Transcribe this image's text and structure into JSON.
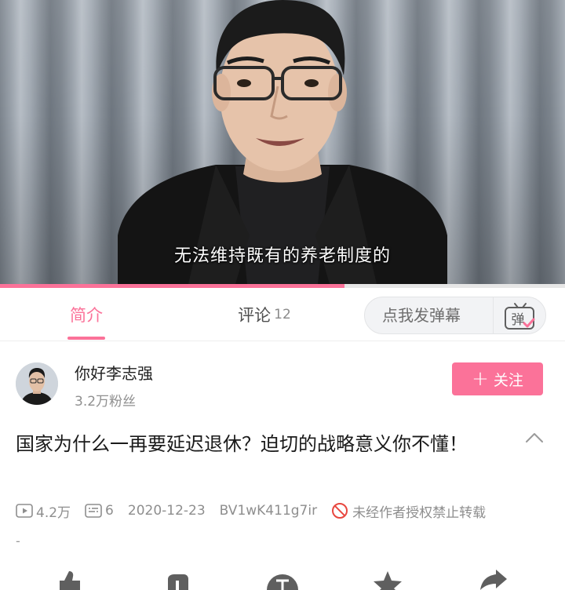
{
  "video": {
    "subtitle": "无法维持既有的养老制度的",
    "progress": 0.61
  },
  "tabs": {
    "intro_label": "简介",
    "comments_label": "评论",
    "comments_count": "12"
  },
  "danmaku_input": {
    "placeholder": "点我发弹幕",
    "icon": "danmaku-settings-icon",
    "icon_text": "弹"
  },
  "uploader": {
    "name": "你好李志强",
    "fans": "3.2万粉丝",
    "follow_label": "关注"
  },
  "title": "国家为什么一再要延迟退休？迫切的战略意义你不懂！",
  "stats": {
    "views": "4.2万",
    "danmaku": "6",
    "date": "2020-12-23",
    "bvid": "BV1wK411g7ir",
    "copyright": "未经作者授权禁止转载"
  },
  "description": "-",
  "colors": {
    "accent": "#fb7299",
    "text_primary": "#212121",
    "text_secondary": "#8e8e8e",
    "tab_divider": "#eeeeee"
  },
  "action_icons": [
    "like-icon",
    "dislike-icon",
    "coin-icon",
    "favorite-icon",
    "share-icon"
  ]
}
